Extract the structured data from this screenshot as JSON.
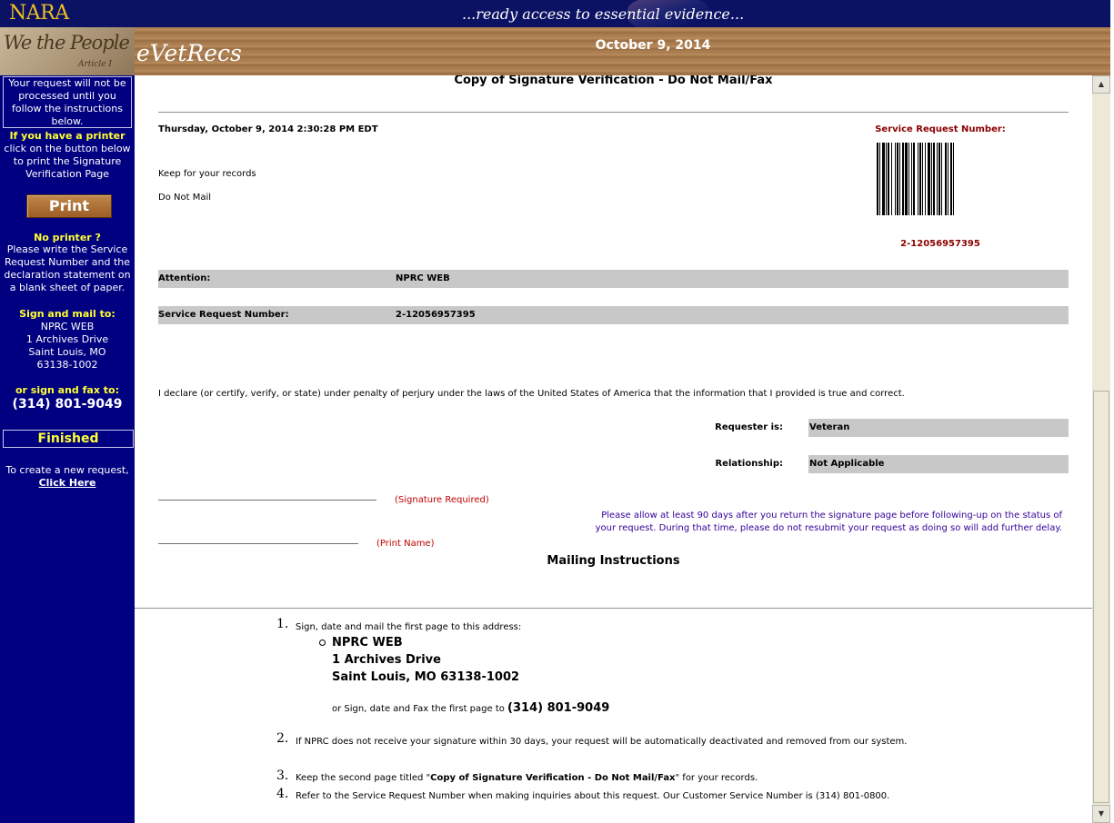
{
  "header": {
    "logo": "NARA",
    "tagline": "...ready access to essential evidence...",
    "banner_text": "We the People",
    "banner_sub": "Article I",
    "app_name": "eVetRecs",
    "date": "October 9, 2014"
  },
  "sidebar": {
    "notice": "Your request will not be processed until you follow the instructions below.",
    "printer_heading": "If you have a printer",
    "printer_text": "click on the button below to print the Signature Verification Page",
    "print_button": "Print",
    "noprinter_heading": "No printer ?",
    "noprinter_text": "Please write the Service Request Number and the declaration statement on a blank sheet of paper.",
    "mail_heading": "Sign and mail to:",
    "mail_address": [
      "NPRC WEB",
      "1 Archives Drive",
      "Saint Louis, MO",
      "63138-1002"
    ],
    "fax_heading": "or sign and fax to:",
    "fax_number": "(314) 801-9049",
    "finished_label": "Finished",
    "new_request_text": "To create a new request,",
    "click_here": "Click Here"
  },
  "document": {
    "title": "Copy of Signature Verification - Do Not Mail/Fax",
    "timestamp": "Thursday, October 9, 2014 2:30:28 PM EDT",
    "keep_records": "Keep for your records",
    "do_not_mail": "Do Not Mail",
    "service_request_heading": "Service Request Number:",
    "service_request_value": "2-12056957395",
    "attention_label": "Attention:",
    "attention_value": "NPRC WEB",
    "srn_label": "Service Request Number:",
    "srn_value": "2-12056957395",
    "declaration": "I declare (or certify, verify, or state) under penalty of perjury under the laws of the United States of America that the information that I provided is true and correct.",
    "requester_label": "Requester is:",
    "requester_value": "Veteran",
    "relationship_label": "Relationship:",
    "relationship_value": "Not Applicable",
    "signature_label": "(Signature Required)",
    "print_name_label": "(Print Name)",
    "allow_note_line1": "Please allow at least 90 days after you return the signature page before following-up on the status of",
    "allow_note_line2": "your request. During that time, please do not resubmit your request as doing so will add further delay.",
    "mailing_heading": "Mailing Instructions"
  },
  "instructions": {
    "step1_num": "1.",
    "step1_text": "Sign, date and mail the first page to this address:",
    "address": [
      "NPRC WEB",
      "1 Archives Drive",
      "Saint Louis, MO 63138-1002"
    ],
    "fax_prefix": "or Sign, date and Fax the first page to",
    "fax_number": "(314) 801-9049",
    "step2_num": "2.",
    "step2_text": "If NPRC does not receive your signature within 30 days, your request will be automatically deactivated and removed from our system.",
    "step3_num": "3.",
    "step3_prefix": "Keep the second page titled \"",
    "step3_bold": "Copy of Signature Verification - Do Not Mail/Fax",
    "step3_suffix": "\" for your records.",
    "step4_num": "4.",
    "step4_text": "Refer to the Service Request Number when making inquiries about this request. Our Customer Service Number is (314) 801-0800."
  },
  "colors": {
    "navy": "#000080",
    "header_navy": "#0b1264",
    "accent_yellow": "#ffff33",
    "dark_red": "#8b0000",
    "note_purple": "#330099",
    "field_gray": "#c8c8c8"
  }
}
